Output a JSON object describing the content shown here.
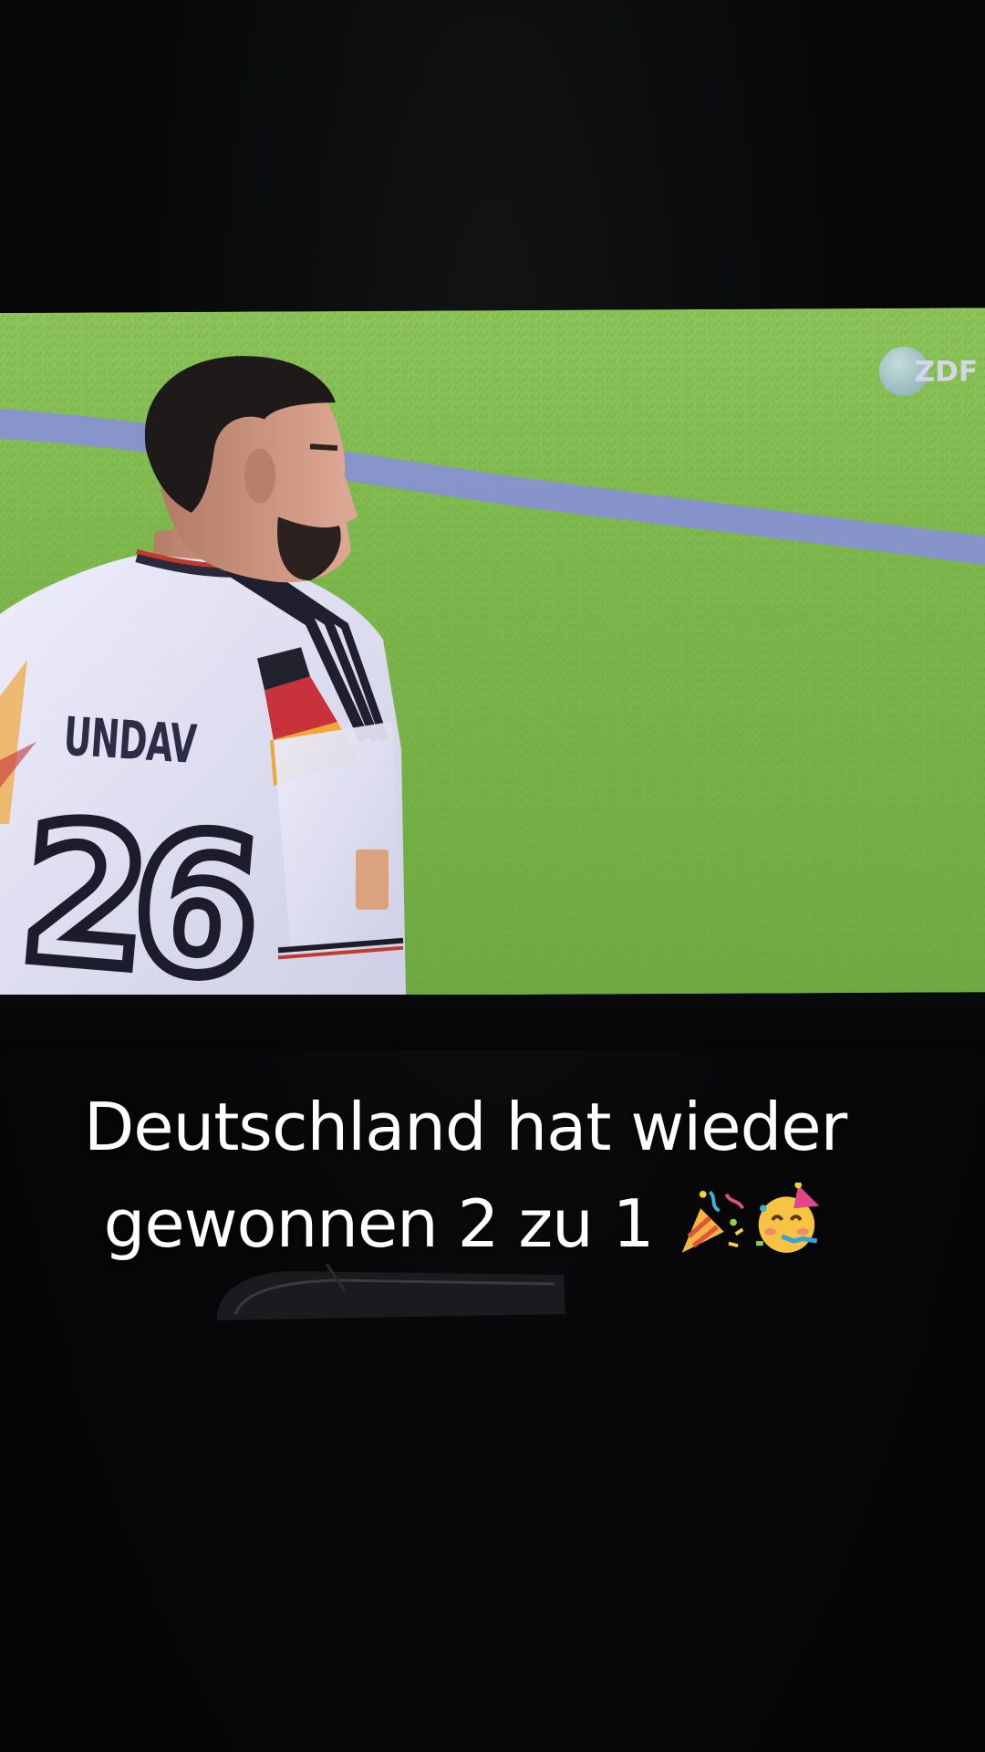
{
  "broadcast": {
    "channel_logo": "ZDF",
    "jersey_name": "UNDAV",
    "jersey_number": "26"
  },
  "caption": {
    "line1": "Deutschland hat wieder",
    "line2": "gewonnen 2 zu 1",
    "emojis": [
      "party-popper-icon",
      "partying-face-icon"
    ]
  },
  "colors": {
    "pitch_green": "#7fb84a",
    "pitch_line": "#8790d8",
    "jersey_white": "#e3e3f5",
    "caption_text": "#ffffff",
    "background": "#060607"
  }
}
